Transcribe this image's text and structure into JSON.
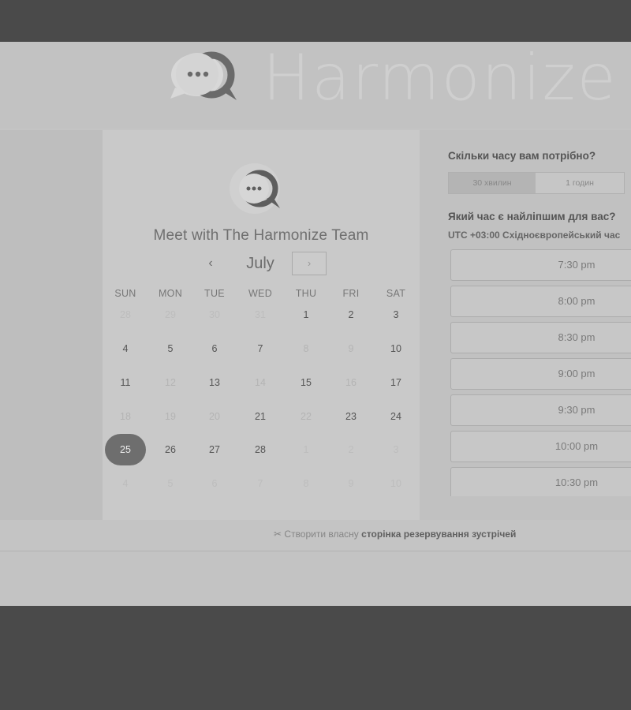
{
  "brand": {
    "name": "Harmonize",
    "icon": "chat-bubble-logo-icon"
  },
  "calendar": {
    "title": "Meet with The Harmonize Team",
    "month": "July",
    "prev_label": "‹",
    "next_label": "›",
    "weekdays": [
      "SUN",
      "MON",
      "TUE",
      "WED",
      "THU",
      "FRI",
      "SAT"
    ],
    "weeks": [
      [
        {
          "d": "28",
          "s": "outside"
        },
        {
          "d": "29",
          "s": "outside"
        },
        {
          "d": "30",
          "s": "outside"
        },
        {
          "d": "31",
          "s": "outside"
        },
        {
          "d": "1",
          "s": "available"
        },
        {
          "d": "2",
          "s": "available"
        },
        {
          "d": "3",
          "s": "available"
        }
      ],
      [
        {
          "d": "4",
          "s": "available"
        },
        {
          "d": "5",
          "s": "available"
        },
        {
          "d": "6",
          "s": "available"
        },
        {
          "d": "7",
          "s": "available"
        },
        {
          "d": "8",
          "s": "unavailable"
        },
        {
          "d": "9",
          "s": "unavailable"
        },
        {
          "d": "10",
          "s": "available"
        }
      ],
      [
        {
          "d": "11",
          "s": "available"
        },
        {
          "d": "12",
          "s": "unavailable"
        },
        {
          "d": "13",
          "s": "available"
        },
        {
          "d": "14",
          "s": "unavailable"
        },
        {
          "d": "15",
          "s": "available"
        },
        {
          "d": "16",
          "s": "unavailable"
        },
        {
          "d": "17",
          "s": "available"
        }
      ],
      [
        {
          "d": "18",
          "s": "unavailable"
        },
        {
          "d": "19",
          "s": "unavailable"
        },
        {
          "d": "20",
          "s": "unavailable"
        },
        {
          "d": "21",
          "s": "available"
        },
        {
          "d": "22",
          "s": "unavailable"
        },
        {
          "d": "23",
          "s": "available"
        },
        {
          "d": "24",
          "s": "available"
        }
      ],
      [
        {
          "d": "25",
          "s": "selected"
        },
        {
          "d": "26",
          "s": "available"
        },
        {
          "d": "27",
          "s": "available"
        },
        {
          "d": "28",
          "s": "available"
        },
        {
          "d": "1",
          "s": "outside"
        },
        {
          "d": "2",
          "s": "outside"
        },
        {
          "d": "3",
          "s": "outside"
        }
      ],
      [
        {
          "d": "4",
          "s": "outside"
        },
        {
          "d": "5",
          "s": "outside"
        },
        {
          "d": "6",
          "s": "outside"
        },
        {
          "d": "7",
          "s": "outside"
        },
        {
          "d": "8",
          "s": "outside"
        },
        {
          "d": "9",
          "s": "outside"
        },
        {
          "d": "10",
          "s": "outside"
        }
      ]
    ]
  },
  "booking": {
    "duration_question": "Скільки часу вам потрібно?",
    "durations": [
      "30 хвилин",
      "1 годин"
    ],
    "selected_duration": "30 хвилин",
    "time_question": "Який час є найліпшим для вас?",
    "timezone": "UTC +03:00 Східноєвропейський час",
    "slots": [
      "7:30 pm",
      "8:00 pm",
      "8:30 pm",
      "9:00 pm",
      "9:30 pm",
      "10:00 pm",
      "10:30 pm"
    ]
  },
  "footer": {
    "icon": "scissors-icon",
    "prefix": "Створити власну ",
    "link_bold": "сторінка резервування зустрічей"
  }
}
